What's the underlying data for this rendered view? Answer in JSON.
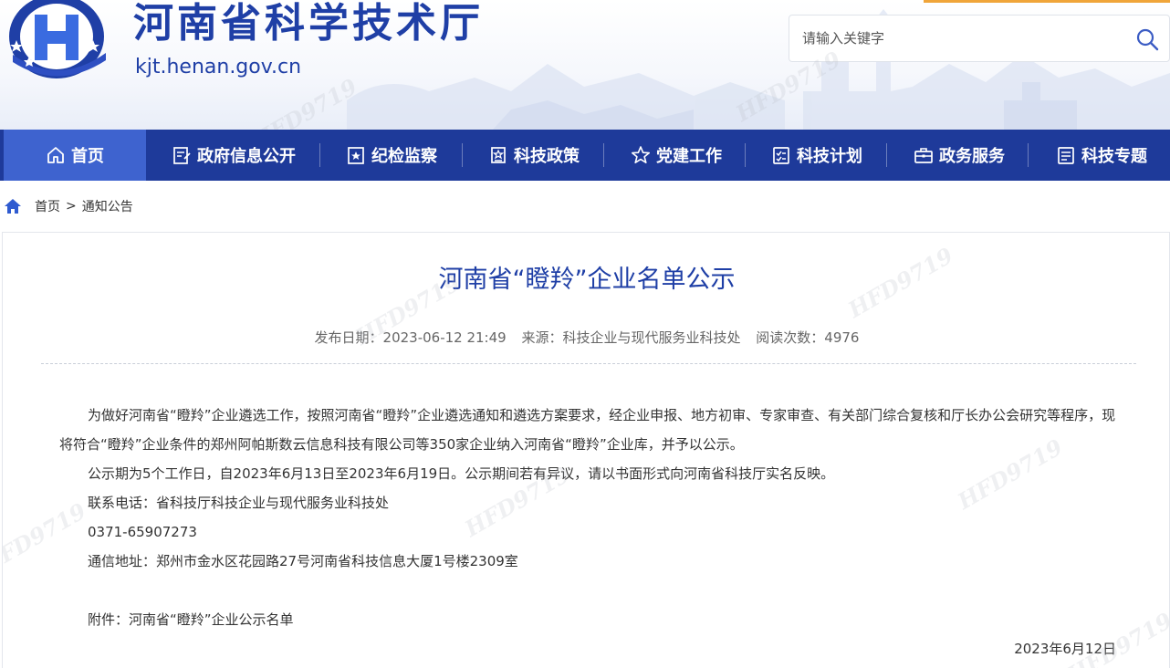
{
  "header": {
    "site_title": "河南省科学技术厅",
    "site_domain": "kjt.henan.gov.cn",
    "search_placeholder": "请输入关键字",
    "brand_color": "#1f3fa6"
  },
  "nav": {
    "items": [
      {
        "label": "首页",
        "icon": "home-icon",
        "active": true
      },
      {
        "label": "政府信息公开",
        "icon": "document-edit-icon"
      },
      {
        "label": "纪检监察",
        "icon": "star-badge-icon"
      },
      {
        "label": "科技政策",
        "icon": "award-icon"
      },
      {
        "label": "党建工作",
        "icon": "star-icon"
      },
      {
        "label": "科技计划",
        "icon": "checklist-icon"
      },
      {
        "label": "政务服务",
        "icon": "briefcase-icon"
      },
      {
        "label": "科技专题",
        "icon": "list-icon"
      }
    ],
    "bg_color": "#1e3a9a",
    "active_color": "#3e63cf"
  },
  "breadcrumb": {
    "home": "首页",
    "separator": ">",
    "current": "通知公告"
  },
  "article": {
    "title": "河南省“瞪羚”企业名单公示",
    "publish_date": "发布日期：2023-06-12 21:49",
    "source": "来源：科技企业与现代服务业科技处",
    "views": "阅读次数：4976",
    "paragraphs": [
      "为做好河南省“瞪羚”企业遴选工作，按照河南省“瞪羚”企业遴选通知和遴选方案要求，经企业申报、地方初审、专家审查、有关部门综合复核和厅长办公会研究等程序，现将符合“瞪羚”企业条件的郑州阿帕斯数云信息科技有限公司等350家企业纳入河南省“瞪羚”企业库，并予以公示。",
      "公示期为5个工作日，自2023年6月13日至2023年6月19日。公示期间若有异议，请以书面形式向河南省科技厅实名反映。",
      "联系电话：省科技厅科技企业与现代服务业科技处",
      "0371-65907273",
      "通信地址：郑州市金水区花园路27号河南省科技信息大厦1号楼2309室"
    ],
    "attachment": "附件：河南省“瞪羚”企业公示名单",
    "sign_date": "2023年6月12日"
  },
  "watermark": "HFD9719"
}
